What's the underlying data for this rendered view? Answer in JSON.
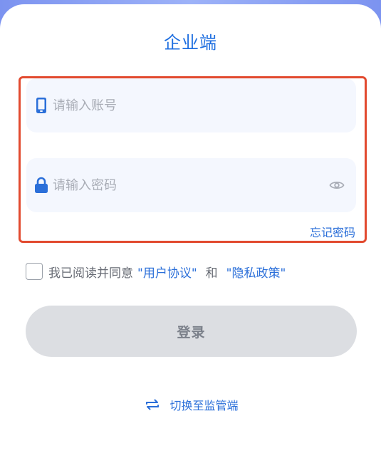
{
  "header": {
    "title": "企业端"
  },
  "form": {
    "account": {
      "placeholder": "请输入账号",
      "value": ""
    },
    "password": {
      "placeholder": "请输入密码",
      "value": ""
    },
    "forgot_password": "忘记密码"
  },
  "agreement": {
    "checked": false,
    "prefix": "我已阅读并同意",
    "user_agreement": "\"用户协议\"",
    "and": "和",
    "privacy_policy": "\"隐私政策\""
  },
  "login_button": "登录",
  "switch_role": {
    "label": "切换至监管端"
  },
  "colors": {
    "accent": "#2b6fd9",
    "highlight": "#e24a2f",
    "field_bg": "#f4f7fe",
    "button_disabled": "#dcdee2"
  },
  "icons": {
    "account": "phone-icon",
    "password": "lock-icon",
    "toggle_visibility": "eye-icon",
    "switch": "swap-arrows-icon"
  }
}
